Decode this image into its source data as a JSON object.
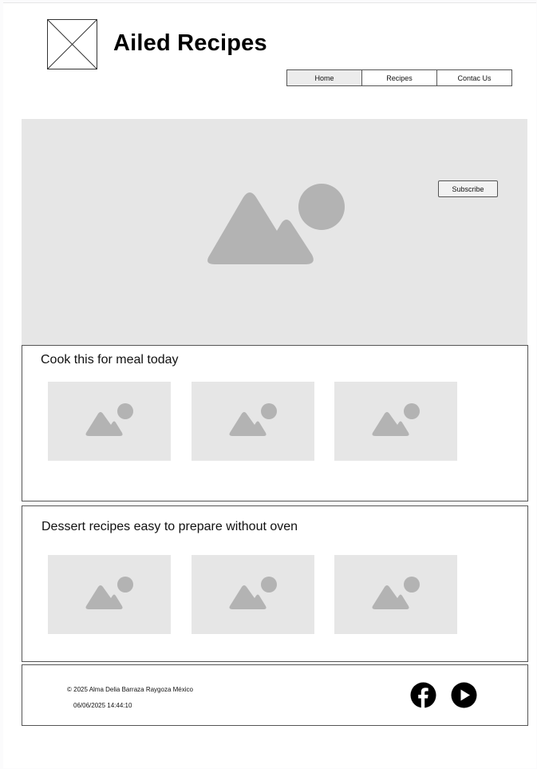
{
  "header": {
    "title": "Ailed Recipes",
    "logo_icon": "image-placeholder-x-icon"
  },
  "nav": {
    "items": [
      {
        "label": "Home",
        "active": true
      },
      {
        "label": "Recipes",
        "active": false
      },
      {
        "label": "Contac Us",
        "active": false
      }
    ]
  },
  "hero": {
    "image_icon": "image-placeholder-icon",
    "subscribe_label": "Subscribe"
  },
  "sections": [
    {
      "title": "Cook this for meal today",
      "cards": [
        "image-placeholder-icon",
        "image-placeholder-icon",
        "image-placeholder-icon"
      ]
    },
    {
      "title": "Dessert recipes easy to prepare without oven",
      "cards": [
        "image-placeholder-icon",
        "image-placeholder-icon",
        "image-placeholder-icon"
      ]
    }
  ],
  "footer": {
    "copyright": "© 2025 Alma Delia Barraza Raygoza México",
    "timestamp": "06/06/2025 14:44:10",
    "social_icons": [
      "facebook-icon",
      "youtube-play-icon"
    ]
  },
  "colors": {
    "placeholder_bg": "#e6e6e6",
    "placeholder_shape": "#b3b3b3",
    "border": "#555555"
  }
}
